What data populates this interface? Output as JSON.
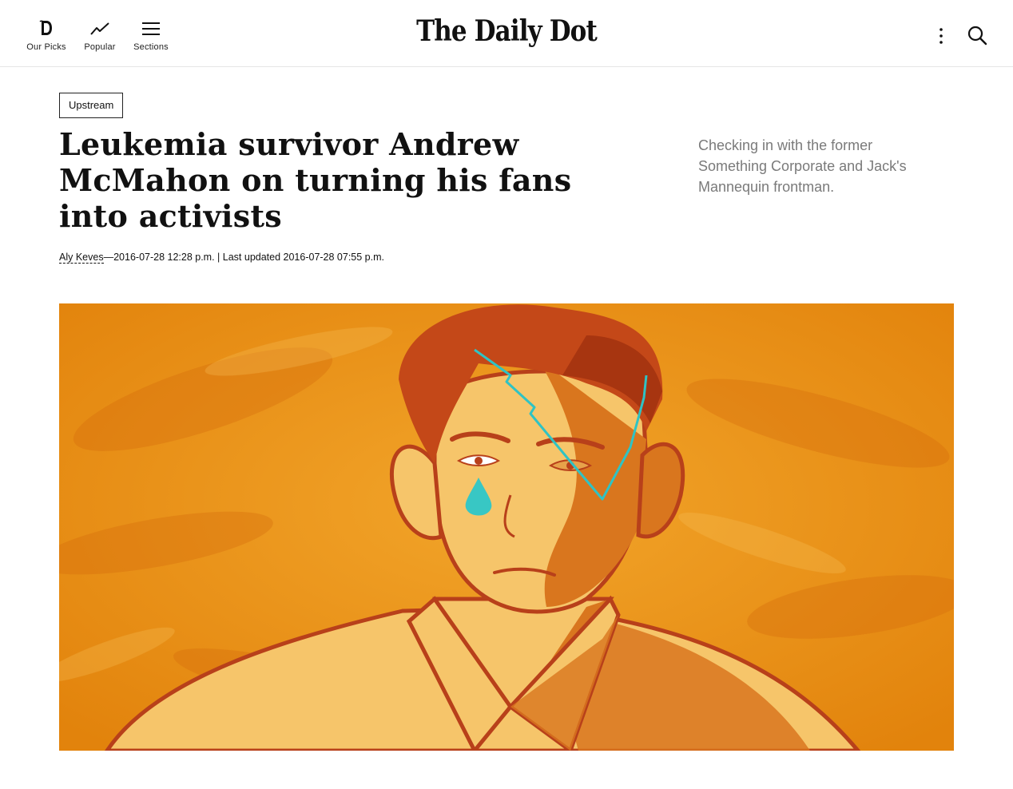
{
  "header": {
    "nav": [
      {
        "label": "Our Picks",
        "icon": "daily-dot-d-icon"
      },
      {
        "label": "Popular",
        "icon": "trending-icon"
      },
      {
        "label": "Sections",
        "icon": "hamburger-menu-icon"
      }
    ],
    "logo_text": "The Daily Dot",
    "right_icons": [
      "more-vertical-icon",
      "search-icon"
    ]
  },
  "article": {
    "section_tag": "Upstream",
    "headline": "Leukemia survivor Andrew McMahon on turning his fans into activists",
    "dek": "Checking in with the former Something Corporate and Jack's Mannequin frontman.",
    "author": "Aly Keves",
    "dateline": "—2016-07-28 12:28 p.m. | Last updated 2016-07-28 07:55 p.m."
  },
  "hero_image": {
    "subject": "illustration-man-teardrop",
    "colors": {
      "background": "#e8900e",
      "hair": "#c44818",
      "skin": "#f6c56a",
      "shadow": "#d9761e",
      "line": "#b8401a",
      "tear": "#38c7c4"
    }
  }
}
